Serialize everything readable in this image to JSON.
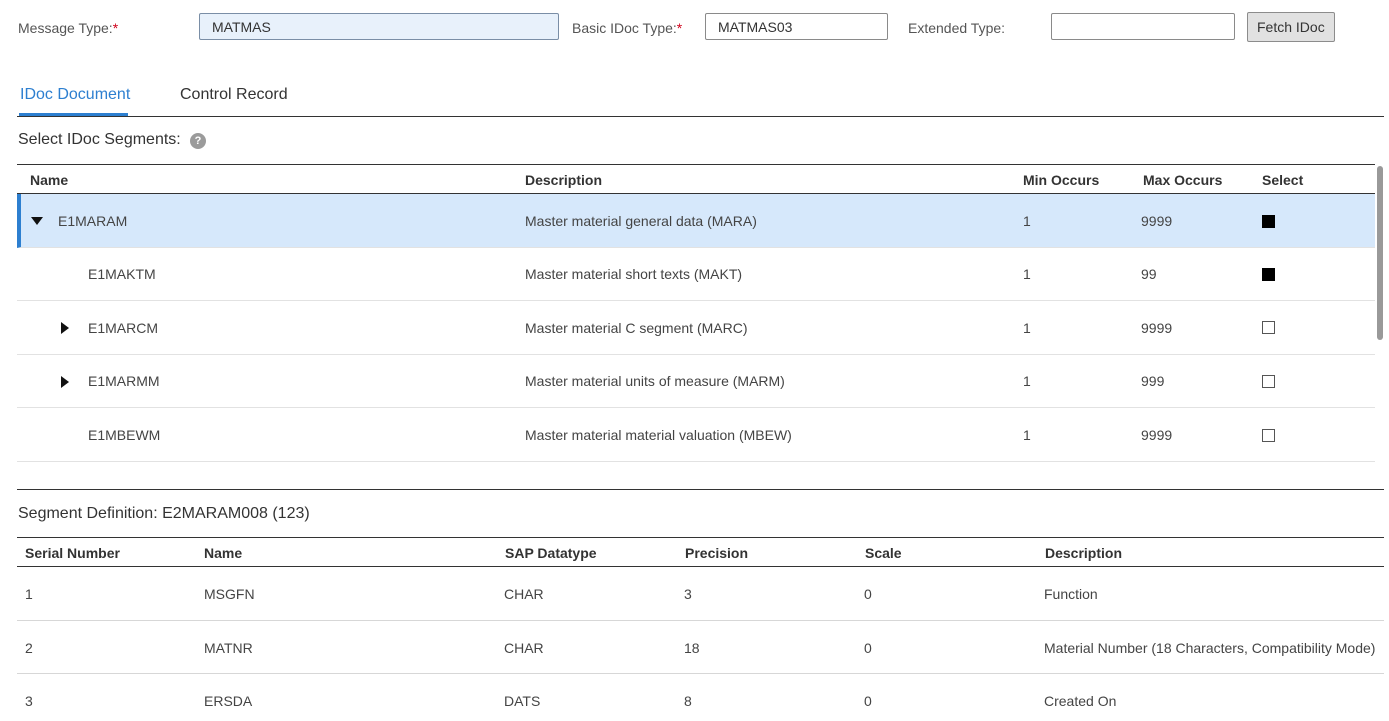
{
  "form": {
    "message_type": {
      "label": "Message Type:",
      "required": "*",
      "value": "MATMAS"
    },
    "basic_idoc_type": {
      "label": "Basic IDoc Type:",
      "required": "*",
      "value": "MATMAS03"
    },
    "extended_type": {
      "label": "Extended Type:",
      "value": ""
    },
    "fetch_button": "Fetch IDoc"
  },
  "tabs": [
    {
      "label": "IDoc Document",
      "active": true
    },
    {
      "label": "Control Record",
      "active": false
    }
  ],
  "segments": {
    "title": "Select IDoc Segments:",
    "help_glyph": "?",
    "columns": [
      "Name",
      "Description",
      "Min Occurs",
      "Max Occurs",
      "Select"
    ],
    "rows": [
      {
        "name": "E1MARAM",
        "description": "Master material general data (MARA)",
        "min": "1",
        "max": "9999",
        "expander": "expanded",
        "selected": true,
        "checked": true
      },
      {
        "name": "E1MAKTM",
        "description": "Master material short texts (MAKT)",
        "min": "1",
        "max": "99",
        "expander": "none",
        "selected": false,
        "checked": true
      },
      {
        "name": "E1MARCM",
        "description": "Master material C segment (MARC)",
        "min": "1",
        "max": "9999",
        "expander": "collapsed",
        "selected": false,
        "checked": false
      },
      {
        "name": "E1MARMM",
        "description": "Master material units of measure (MARM)",
        "min": "1",
        "max": "999",
        "expander": "collapsed",
        "selected": false,
        "checked": false
      },
      {
        "name": "E1MBEWM",
        "description": "Master material material valuation (MBEW)",
        "min": "1",
        "max": "9999",
        "expander": "none",
        "selected": false,
        "checked": false
      }
    ]
  },
  "definition": {
    "title": "Segment Definition: E2MARAM008 (123)",
    "columns": [
      "Serial Number",
      "Name",
      "SAP Datatype",
      "Precision",
      "Scale",
      "Description"
    ],
    "rows": [
      {
        "serial": "1",
        "name": "MSGFN",
        "datatype": "CHAR",
        "precision": "3",
        "scale": "0",
        "description": "Function"
      },
      {
        "serial": "2",
        "name": "MATNR",
        "datatype": "CHAR",
        "precision": "18",
        "scale": "0",
        "description": "Material Number (18 Characters, Compatibility Mode)"
      },
      {
        "serial": "3",
        "name": "ERSDA",
        "datatype": "DATS",
        "precision": "8",
        "scale": "0",
        "description": "Created On"
      }
    ]
  },
  "colors": {
    "accent": "#2d7fd0",
    "selected_row": "#d6e8fb",
    "required": "#d0021b"
  }
}
